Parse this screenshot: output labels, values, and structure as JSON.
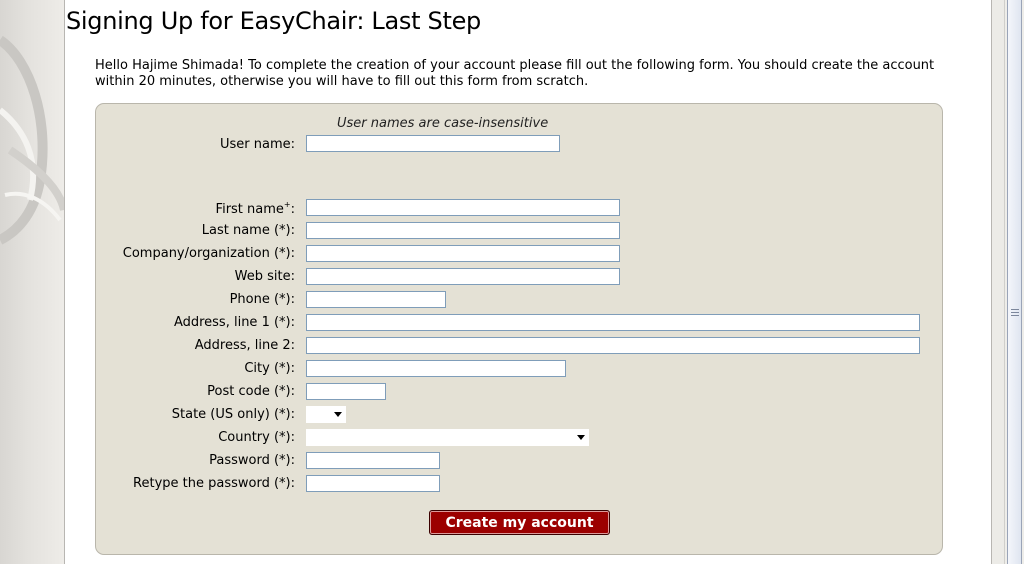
{
  "page": {
    "title": "Signing Up for EasyChair: Last Step",
    "intro": "Hello Hajime Shimada! To complete the creation of your account please fill out the following form. You should create the account within 20 minutes, otherwise you will have to fill out this form from scratch."
  },
  "form": {
    "username_hint": "User names are case-insensitive",
    "fields": {
      "username": {
        "label": "User name:",
        "value": ""
      },
      "first_name": {
        "label": "First name",
        "marker": "+",
        "suffix": ":",
        "value": ""
      },
      "last_name": {
        "label": "Last name (*):",
        "value": ""
      },
      "company": {
        "label": "Company/organization (*):",
        "value": ""
      },
      "website": {
        "label": "Web site:",
        "value": ""
      },
      "phone": {
        "label": "Phone (*):",
        "value": ""
      },
      "address1": {
        "label": "Address, line 1 (*):",
        "value": ""
      },
      "address2": {
        "label": "Address, line 2:",
        "value": ""
      },
      "city": {
        "label": "City (*):",
        "value": ""
      },
      "postcode": {
        "label": "Post code (*):",
        "value": ""
      },
      "state": {
        "label": "State (US only) (*):",
        "value": ""
      },
      "country": {
        "label": "Country (*):",
        "value": ""
      },
      "password": {
        "label": "Password (*):",
        "value": ""
      },
      "password2": {
        "label": "Retype the password (*):",
        "value": ""
      }
    },
    "submit_label": "Create my account"
  },
  "colors": {
    "panel_bg": "#e4e1d5",
    "button_bg": "#9c0000",
    "input_border": "#7f9db9"
  },
  "icons": [
    "chevron-down-icon",
    "scroll-grip-icon"
  ]
}
